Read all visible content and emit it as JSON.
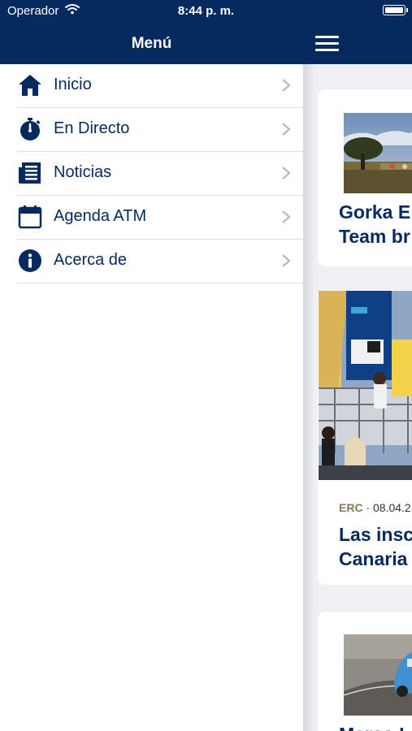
{
  "status_bar": {
    "carrier": "Operador",
    "time": "8:44 p. m."
  },
  "nav": {
    "title": "Menú"
  },
  "menu": {
    "items": [
      {
        "label": "Inicio",
        "icon": "home-icon"
      },
      {
        "label": "En Directo",
        "icon": "stopwatch-icon"
      },
      {
        "label": "Noticias",
        "icon": "newspaper-icon"
      },
      {
        "label": "Agenda ATM",
        "icon": "calendar-icon"
      },
      {
        "label": "Acerca de",
        "icon": "info-icon"
      }
    ]
  },
  "cards": [
    {
      "title_line1": "Gorka E",
      "title_line2": "Team br"
    },
    {
      "tag": "ERC",
      "meta_rest": " · 08.04.2",
      "title_line1": "Las insc",
      "title_line2": "Canaria"
    },
    {
      "title_line1": "Marco L"
    }
  ],
  "colors": {
    "brand_navy": "#062a5e",
    "meta_tag": "#8a7a55"
  }
}
